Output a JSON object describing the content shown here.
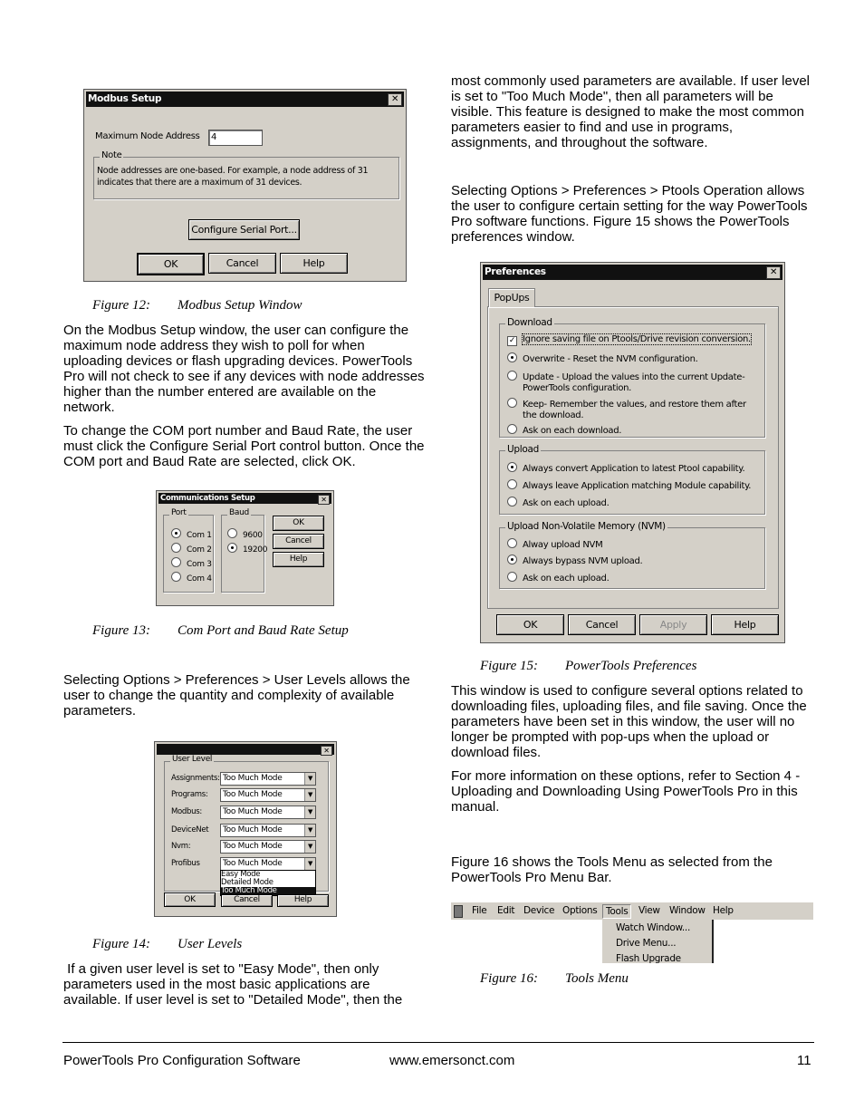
{
  "modbus_dialog": {
    "title": "Modbus Setup",
    "max_node_label": "Maximum Node Address",
    "max_node_value": "4",
    "note_label": "Note",
    "note_text": "Node addresses are one-based.  For example, a node address of 31 indicates that there are a maximum of 31 devices.",
    "configure_button": "Configure Serial Port...",
    "ok": "OK",
    "cancel": "Cancel",
    "help": "Help"
  },
  "fig12": {
    "num": "Figure 12:",
    "title": "Modbus Setup Window"
  },
  "left_paras": [
    "On the Modbus Setup window, the user can configure the maximum node address they wish to poll for when uploading devices or flash upgrading devices. PowerTools Pro will not check to see if any devices with node addresses higher than the number entered are available on the network.",
    "To change the COM port number and Baud Rate, the user must click the Configure Serial Port control button. Once the COM port and Baud Rate are selected, click OK."
  ],
  "comm_dialog": {
    "title": "Communications Setup",
    "port_label": "Port",
    "ports": [
      "Com 1",
      "Com 2",
      "Com 3",
      "Com 4"
    ],
    "selected_port": "Com 1",
    "baud_label": "Baud",
    "bauds": [
      "9600",
      "19200"
    ],
    "selected_baud": "19200",
    "ok": "OK",
    "cancel": "Cancel",
    "help": "Help"
  },
  "fig13": {
    "num": "Figure 13:",
    "title": "Com Port and Baud Rate Setup"
  },
  "user_levels_para": "Selecting Options > Preferences > User Levels allows the user to change the quantity and complexity of available parameters.",
  "user_dialog": {
    "group_label": "User Level",
    "rows": [
      {
        "label": "Assignments:",
        "value": "Too Much Mode"
      },
      {
        "label": "Programs:",
        "value": "Too Much Mode"
      },
      {
        "label": "Modbus:",
        "value": "Too Much Mode"
      },
      {
        "label": "DeviceNet",
        "value": "Too Much Mode"
      },
      {
        "label": "Nvm:",
        "value": "Too Much Mode"
      },
      {
        "label": "Profibus",
        "value": "Too Much Mode"
      }
    ],
    "dropdown_options": [
      "Easy Mode",
      "Detailed Mode",
      "Too Much Mode"
    ],
    "selected_option": "Too Much Mode",
    "ok": "OK",
    "cancel": "Cancel",
    "help": "Help"
  },
  "fig14": {
    "num": "Figure 14:",
    "title": "User Levels"
  },
  "easy_para": " If a given user level is set to \"Easy Mode\", then only parameters used in the most basic applications are available. If user level is set to \"Detailed Mode\", then the",
  "right_paras": [
    "most commonly used parameters are available. If user level is set to \"Too Much Mode\", then all parameters will be visible. This feature is designed to make the most common parameters easier to find and use in programs, assignments, and throughout the software.",
    "Selecting Options > Preferences > Ptools Operation allows the user to configure certain setting for the way PowerTools Pro software functions. Figure 15 shows the PowerTools preferences window."
  ],
  "prefs_dialog": {
    "title": "Preferences",
    "tab": "PopUps",
    "download": {
      "label": "Download",
      "checkbox": "Ignore saving file on Ptools/Drive revision conversion.",
      "checked": true,
      "options": [
        "Overwrite - Reset the NVM configuration.",
        "Update - Upload the values into the current Update-PowerTools configuration.",
        "Keep- Remember the values, and restore them after the download.",
        "Ask on each download."
      ],
      "selected": 0
    },
    "upload": {
      "label": "Upload",
      "options": [
        "Always convert Application to latest Ptool capability.",
        "Always leave Application matching Module capability.",
        "Ask on each upload."
      ],
      "selected": 0
    },
    "nvm": {
      "label": "Upload Non-Volatile Memory (NVM)",
      "options": [
        "Alway upload NVM",
        "Always bypass NVM upload.",
        "Ask on each upload."
      ],
      "selected": 1
    },
    "ok": "OK",
    "cancel": "Cancel",
    "apply": "Apply",
    "help": "Help"
  },
  "fig15": {
    "num": "Figure 15:",
    "title": "PowerTools Preferences"
  },
  "right_paras2": [
    "This window is used to configure several options related to downloading files, uploading files, and file saving. Once the parameters have been set in this window, the user will no longer be prompted with pop-ups when the upload or download files.",
    "For more information on these options, refer to Section 4 - Uploading and Downloading Using PowerTools Pro in this manual."
  ],
  "tools_para": "Figure 16 shows the Tools Menu as selected from the PowerTools Pro Menu Bar.",
  "menubar": {
    "items": [
      "File",
      "Edit",
      "Device",
      "Options",
      "Tools",
      "View",
      "Window",
      "Help"
    ],
    "active": "Tools",
    "tools_items": [
      "Watch Window...",
      "Drive Menu...",
      "Flash Upgrade"
    ]
  },
  "fig16": {
    "num": "Figure 16:",
    "title": "Tools Menu"
  },
  "footer": {
    "left": "PowerTools Pro Configuration Software",
    "center": "www.emersonct.com",
    "page": "11"
  }
}
